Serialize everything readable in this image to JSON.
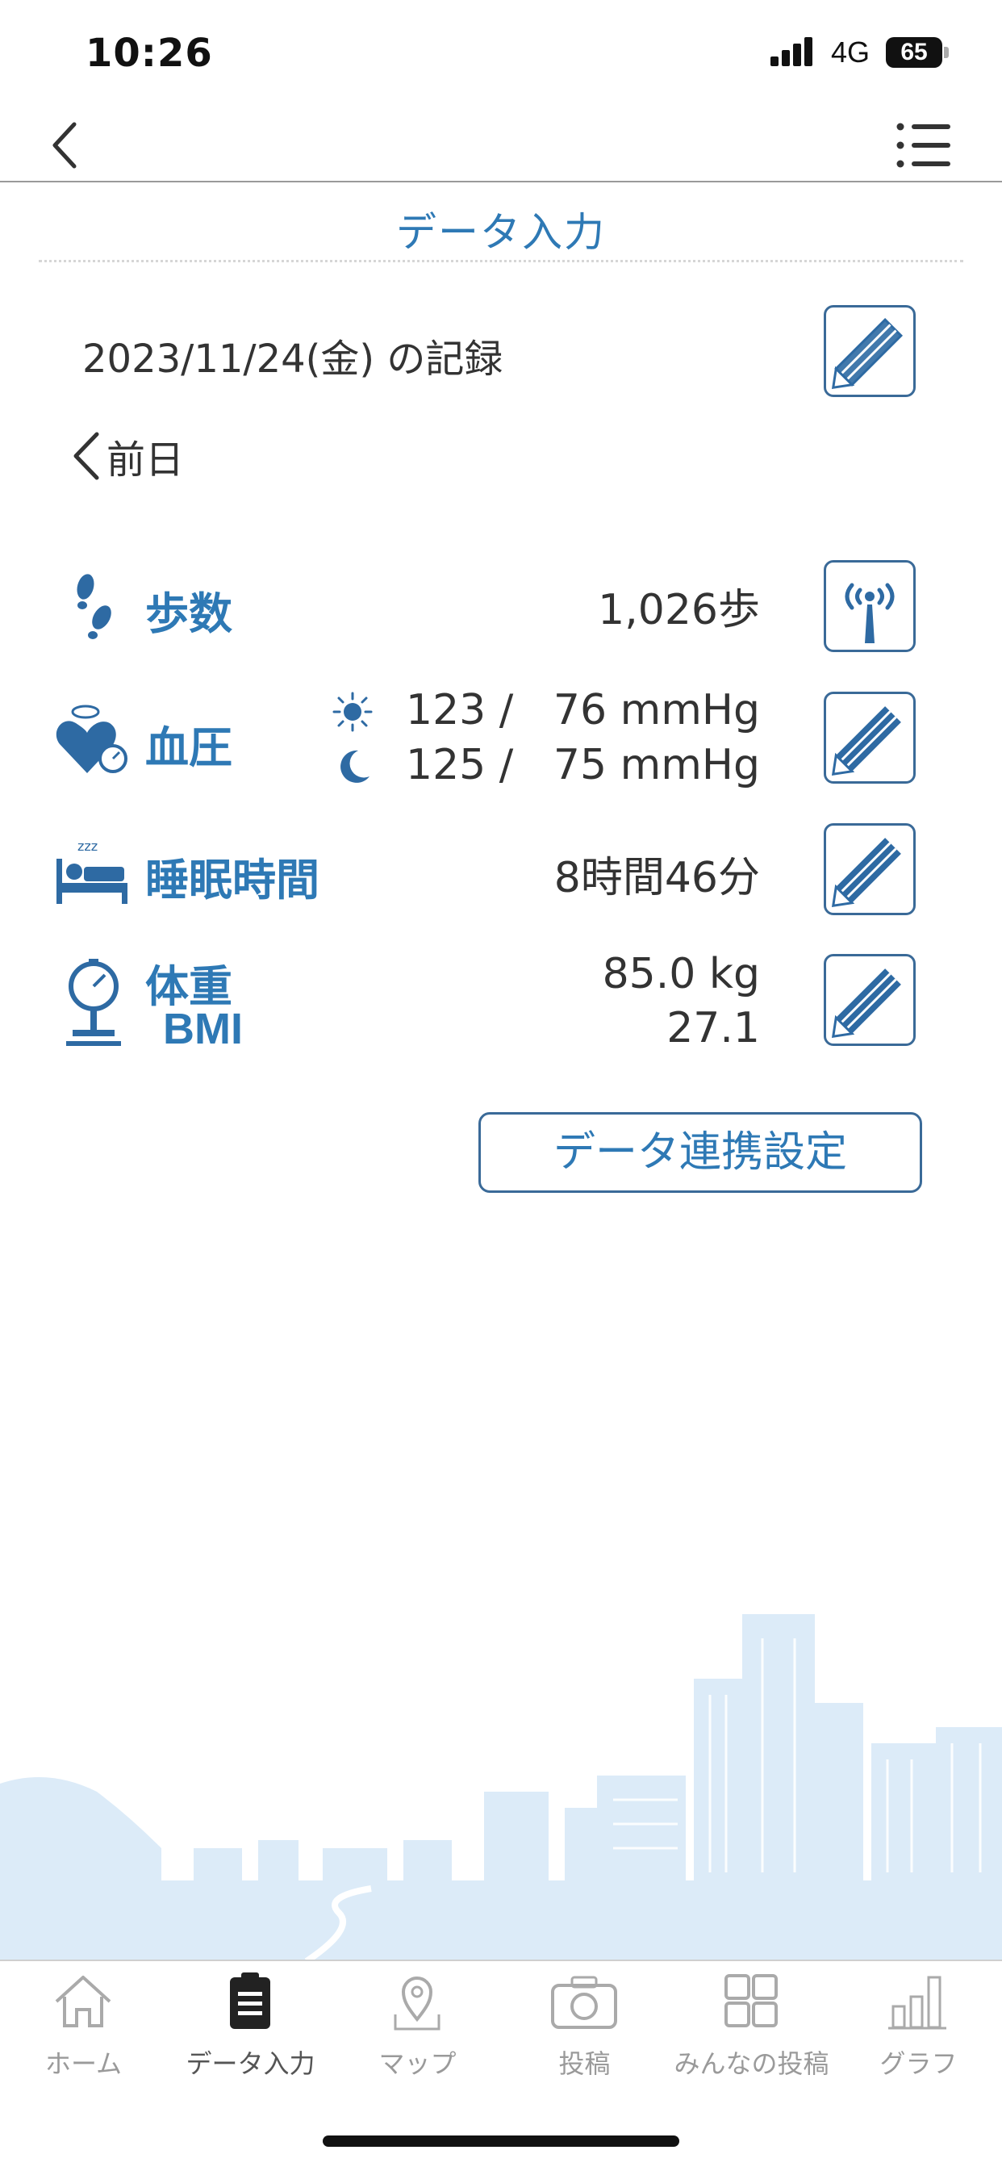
{
  "status": {
    "time": "10:26",
    "network": "4G",
    "battery": "65"
  },
  "header": {
    "title": "データ入力"
  },
  "record": {
    "date_text": "2023/11/24(金) の記録",
    "prev_day_label": "前日"
  },
  "metrics": {
    "steps": {
      "label": "歩数",
      "value": "1,026歩"
    },
    "blood_pressure": {
      "label": "血圧",
      "morning": "123 /   76 mmHg",
      "night": "125 /   75 mmHg"
    },
    "sleep": {
      "label": "睡眠時間",
      "value": "8時間46分"
    },
    "weight": {
      "label": "体重",
      "value": "85.0 kg",
      "bmi_label": "BMI",
      "bmi_value": "27.1"
    }
  },
  "data_link_button": "データ連携設定",
  "tabs": [
    {
      "label": "ホーム",
      "icon": "home-icon",
      "active": false
    },
    {
      "label": "データ入力",
      "icon": "clipboard-icon",
      "active": true
    },
    {
      "label": "マップ",
      "icon": "map-pin-icon",
      "active": false
    },
    {
      "label": "投稿",
      "icon": "camera-icon",
      "active": false
    },
    {
      "label": "みんなの投稿",
      "icon": "grid-icon",
      "active": false
    },
    {
      "label": "グラフ",
      "icon": "bar-chart-icon",
      "active": false
    }
  ],
  "colors": {
    "accent": "#2e79b5",
    "border": "#3a6a98",
    "skyline": "#dcebf8"
  }
}
